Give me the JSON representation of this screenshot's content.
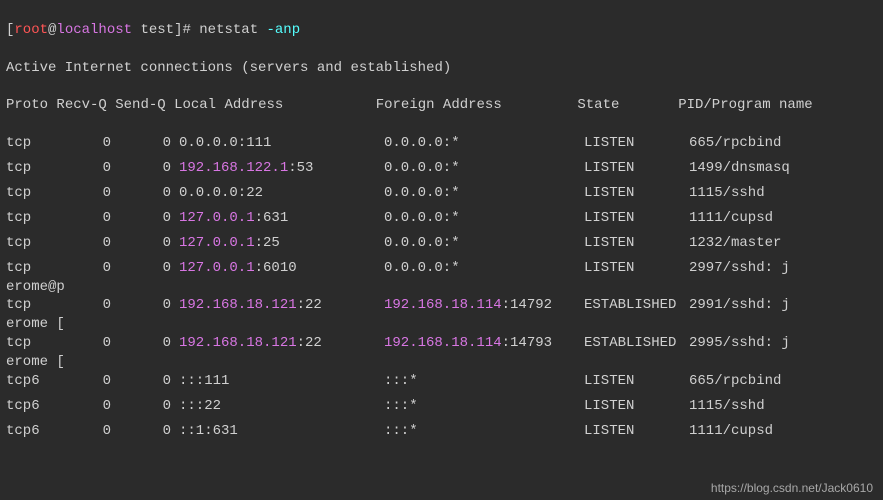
{
  "prompt": {
    "open": "[",
    "user": "root",
    "at": "@",
    "host": "localhost",
    "path": " test",
    "close": "]# ",
    "command": "netstat ",
    "flag": "-anp"
  },
  "title_line": "Active Internet connections (servers and established)",
  "header": {
    "proto": "Proto",
    "recvq": "Recv-Q",
    "sendq": "Send-Q",
    "local": "Local Address",
    "foreign": "Foreign Address",
    "state": "State",
    "pid": "PID/Program name"
  },
  "rows": [
    {
      "proto": "tcp",
      "recvq": "0",
      "sendq": "0",
      "local_ip": "",
      "local_rest": "0.0.0.0:111",
      "foreign_ip": "",
      "foreign_rest": "0.0.0.0:*",
      "state": "LISTEN",
      "pid": "665/rpcbind",
      "cont": ""
    },
    {
      "proto": "tcp",
      "recvq": "0",
      "sendq": "0",
      "local_ip": "192.168.122.1",
      "local_rest": ":53",
      "foreign_ip": "",
      "foreign_rest": "0.0.0.0:*",
      "state": "LISTEN",
      "pid": "1499/dnsmasq",
      "cont": ""
    },
    {
      "proto": "tcp",
      "recvq": "0",
      "sendq": "0",
      "local_ip": "",
      "local_rest": "0.0.0.0:22",
      "foreign_ip": "",
      "foreign_rest": "0.0.0.0:*",
      "state": "LISTEN",
      "pid": "1115/sshd",
      "cont": ""
    },
    {
      "proto": "tcp",
      "recvq": "0",
      "sendq": "0",
      "local_ip": "127.0.0.1",
      "local_rest": ":631",
      "foreign_ip": "",
      "foreign_rest": "0.0.0.0:*",
      "state": "LISTEN",
      "pid": "1111/cupsd",
      "cont": ""
    },
    {
      "proto": "tcp",
      "recvq": "0",
      "sendq": "0",
      "local_ip": "127.0.0.1",
      "local_rest": ":25",
      "foreign_ip": "",
      "foreign_rest": "0.0.0.0:*",
      "state": "LISTEN",
      "pid": "1232/master",
      "cont": ""
    },
    {
      "proto": "tcp",
      "recvq": "0",
      "sendq": "0",
      "local_ip": "127.0.0.1",
      "local_rest": ":6010",
      "foreign_ip": "",
      "foreign_rest": "0.0.0.0:*",
      "state": "LISTEN",
      "pid": "2997/sshd: j",
      "cont": "erome@p"
    },
    {
      "proto": "tcp",
      "recvq": "0",
      "sendq": "0",
      "local_ip": "192.168.18.121",
      "local_rest": ":22",
      "foreign_ip": "192.168.18.114",
      "foreign_rest": ":14792",
      "state": "ESTABLISHED",
      "pid": "2991/sshd: j",
      "cont": "erome ["
    },
    {
      "proto": "tcp",
      "recvq": "0",
      "sendq": "0",
      "local_ip": "192.168.18.121",
      "local_rest": ":22",
      "foreign_ip": "192.168.18.114",
      "foreign_rest": ":14793",
      "state": "ESTABLISHED",
      "pid": "2995/sshd: j",
      "cont": "erome ["
    },
    {
      "proto": "tcp6",
      "recvq": "0",
      "sendq": "0",
      "local_ip": "",
      "local_rest": ":::111",
      "foreign_ip": "",
      "foreign_rest": ":::*",
      "state": "LISTEN",
      "pid": "665/rpcbind",
      "cont": ""
    },
    {
      "proto": "tcp6",
      "recvq": "0",
      "sendq": "0",
      "local_ip": "",
      "local_rest": ":::22",
      "foreign_ip": "",
      "foreign_rest": ":::*",
      "state": "LISTEN",
      "pid": "1115/sshd",
      "cont": ""
    },
    {
      "proto": "tcp6",
      "recvq": "0",
      "sendq": "0",
      "local_ip": "",
      "local_rest": "::1:631",
      "foreign_ip": "",
      "foreign_rest": ":::*",
      "state": "LISTEN",
      "pid": "1111/cupsd",
      "cont": ""
    }
  ],
  "watermark": "https://blog.csdn.net/Jack0610"
}
